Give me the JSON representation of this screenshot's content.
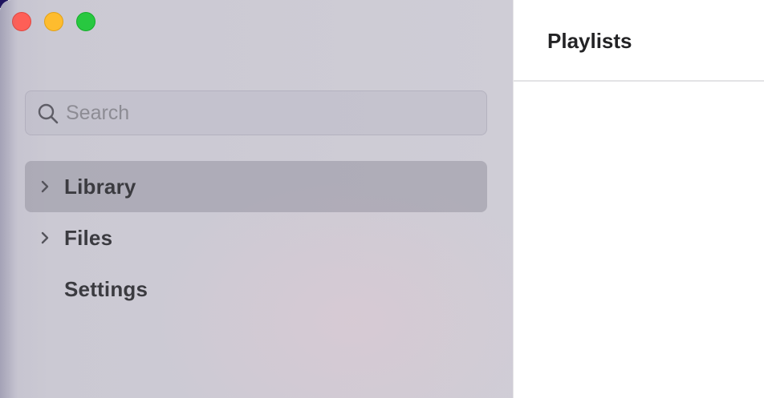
{
  "window": {
    "controls": {
      "close_color": "#fe5f57",
      "minimize_color": "#febc2e",
      "zoom_color": "#28c840"
    }
  },
  "sidebar": {
    "search": {
      "placeholder": "Search",
      "value": "",
      "icon": "search-icon"
    },
    "items": [
      {
        "label": "Library",
        "icon": "chevron-right-icon",
        "selected": true
      },
      {
        "label": "Files",
        "icon": "chevron-right-icon",
        "selected": false
      },
      {
        "label": "Settings",
        "icon": null,
        "selected": false
      }
    ]
  },
  "main": {
    "title": "Playlists"
  }
}
